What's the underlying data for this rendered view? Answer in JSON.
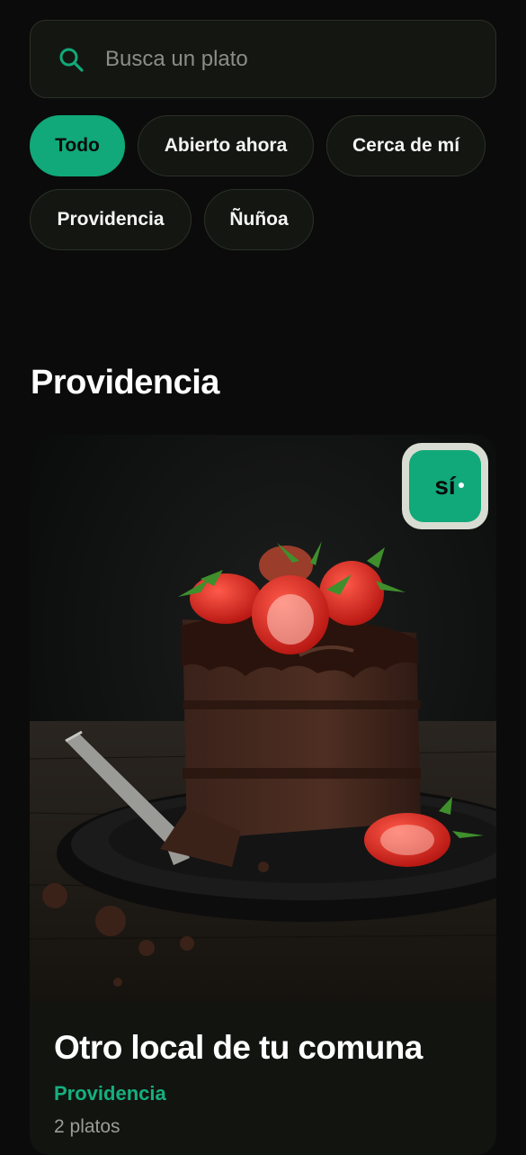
{
  "search": {
    "placeholder": "Busca un plato",
    "icon": "search-icon",
    "accent": "#11a979"
  },
  "filters": [
    {
      "label": "Todo",
      "active": true
    },
    {
      "label": "Abierto ahora",
      "active": false
    },
    {
      "label": "Cerca de mí",
      "active": false
    },
    {
      "label": "Providencia",
      "active": false
    },
    {
      "label": "Ñuñoa",
      "active": false
    }
  ],
  "section": {
    "title": "Providencia"
  },
  "card": {
    "image": "chocolate-cake-with-strawberries",
    "badge": "sí",
    "title": "Otro local de tu comuna",
    "location": "Providencia",
    "count": "2 platos"
  },
  "colors": {
    "background": "#0b0b0b",
    "surface": "#141612",
    "accent": "#11a979",
    "muted_text": "#9a9c97"
  }
}
